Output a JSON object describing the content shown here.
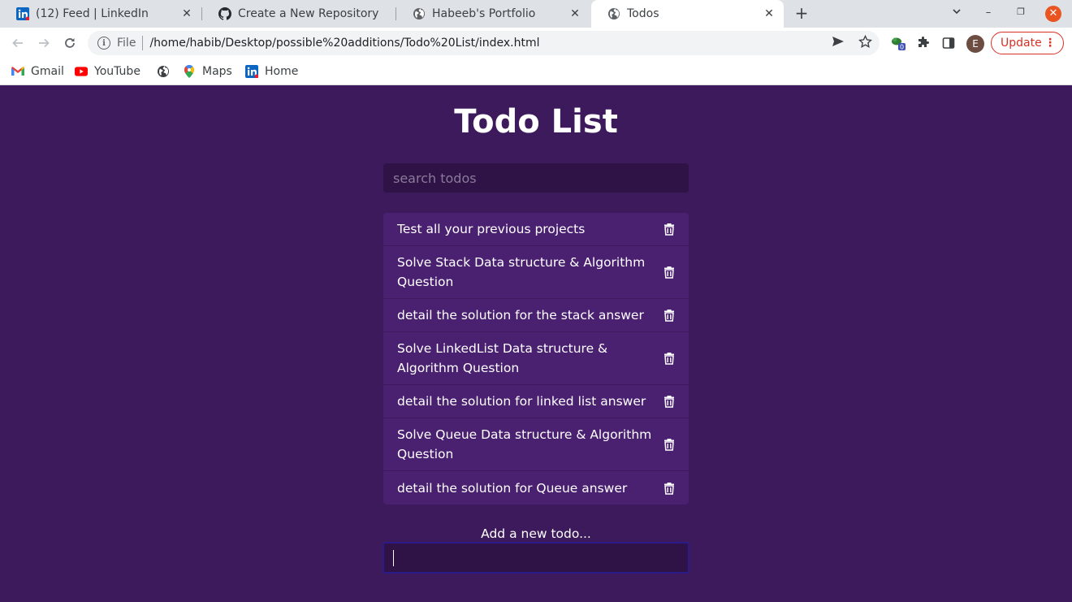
{
  "browser": {
    "tabs": [
      {
        "title": "(12) Feed | LinkedIn",
        "icon": "linkedin-icon"
      },
      {
        "title": "Create a New Repository",
        "icon": "github-icon"
      },
      {
        "title": "Habeeb's Portfolio",
        "icon": "globe-icon"
      },
      {
        "title": "Todos",
        "icon": "globe-icon",
        "active": true
      }
    ],
    "address": {
      "scheme": "File",
      "url": "/home/habib/Desktop/possible%20additions/Todo%20List/index.html"
    },
    "extension_badge": "0",
    "profile_initial": "E",
    "update_label": "Update",
    "bookmarks": [
      {
        "label": "Gmail",
        "icon": "gmail-icon"
      },
      {
        "label": "YouTube",
        "icon": "youtube-icon"
      },
      {
        "label": "",
        "icon": "globe-icon"
      },
      {
        "label": "Maps",
        "icon": "maps-icon"
      },
      {
        "label": "Home",
        "icon": "linkedin-icon"
      }
    ]
  },
  "app": {
    "title": "Todo List",
    "search_placeholder": "search todos",
    "todos": [
      "Test all your previous projects",
      "Solve Stack Data structure & Algorithm Question",
      "detail the solution for the stack answer",
      "Solve LinkedList Data structure & Algorithm Question",
      "detail the solution for linked list answer",
      "Solve Queue Data structure & Algorithm Question",
      "detail the solution for Queue answer"
    ],
    "add_label": "Add a new todo...",
    "add_value": ""
  },
  "colors": {
    "page_background": "#3d1a5b",
    "todo_background": "#4a2070",
    "input_background": "#2f1246",
    "update_accent": "#d93025"
  }
}
